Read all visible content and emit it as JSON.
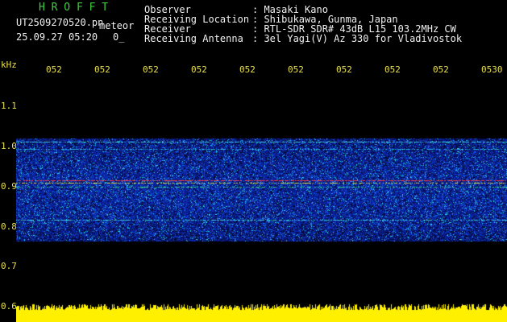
{
  "header": {
    "app_title": "H R O F F T",
    "filename": "UT2509270520.pn",
    "meteor_label": "meteor",
    "datetime": "25.09.27 05:20",
    "meteor_count": "0_",
    "info_labels": [
      "Observer",
      "Receiving Location",
      "Receiver",
      "Receiving Antenna"
    ],
    "info_values": [
      ": Masaki Kano",
      ": Shibukawa, Gunma, Japan",
      ": RTL-SDR SDR# 43dB L15 103.2MHz CW",
      ": 3el Yagi(V) Az 330 for Vladivostok"
    ]
  },
  "axes": {
    "y_unit": "kHz",
    "y_ticks": [
      "1.1",
      "1.0",
      "0.9",
      "0.8",
      "0.7",
      "0.6"
    ],
    "x_ticks": [
      "052",
      "052",
      "052",
      "052",
      "052",
      "052",
      "052",
      "052",
      "052",
      "0530"
    ]
  },
  "colors": {
    "header_green": "#3ecf3e",
    "label_yellow": "#e8e04a",
    "noise_blue": "#1030c0",
    "signal_red": "#ff3030",
    "envelope_yellow": "#ffff00"
  }
}
